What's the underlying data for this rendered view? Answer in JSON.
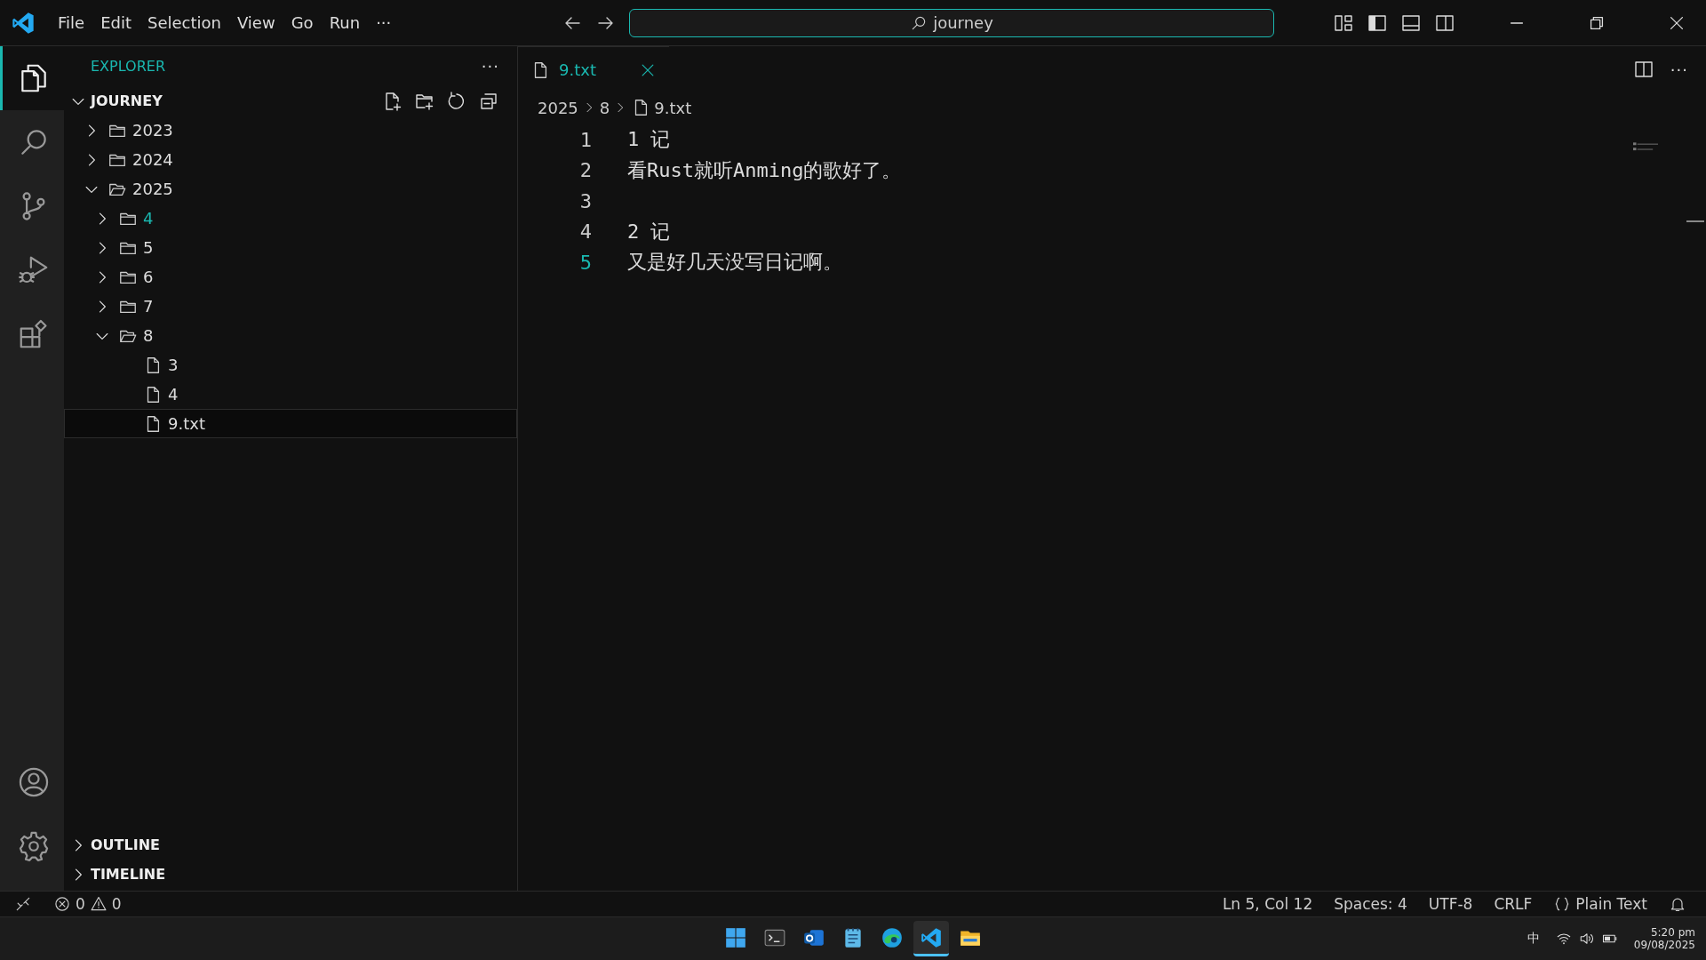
{
  "title_bar": {
    "menu": [
      "File",
      "Edit",
      "Selection",
      "View",
      "Go",
      "Run"
    ],
    "more": "···",
    "search": {
      "value": "journey"
    }
  },
  "activity_bar": {
    "items": [
      {
        "kind": "explorer",
        "selected": true
      },
      {
        "kind": "search",
        "selected": false
      },
      {
        "kind": "source-control",
        "selected": false
      },
      {
        "kind": "run-debug",
        "selected": false
      },
      {
        "kind": "extensions",
        "selected": false
      }
    ],
    "bottom": [
      {
        "kind": "account"
      },
      {
        "kind": "settings"
      }
    ]
  },
  "sidebar": {
    "title": "EXPLORER",
    "more": "···",
    "root": {
      "label": "JOURNEY",
      "expanded": true
    },
    "tree": [
      {
        "kind": "folder",
        "label": "2023",
        "expanded": false,
        "highlighted": false,
        "selected": false
      },
      {
        "kind": "folder",
        "label": "2024",
        "expanded": false,
        "highlighted": false,
        "selected": false
      },
      {
        "kind": "folder",
        "label": "2025",
        "expanded": true,
        "highlighted": false,
        "selected": false,
        "children": [
          {
            "kind": "folder",
            "label": "4",
            "expanded": false,
            "highlighted": true,
            "selected": false
          },
          {
            "kind": "folder",
            "label": "5",
            "expanded": false,
            "highlighted": false,
            "selected": false
          },
          {
            "kind": "folder",
            "label": "6",
            "expanded": false,
            "highlighted": false,
            "selected": false
          },
          {
            "kind": "folder",
            "label": "7",
            "expanded": false,
            "highlighted": false,
            "selected": false
          },
          {
            "kind": "folder",
            "label": "8",
            "expanded": true,
            "highlighted": false,
            "selected": false,
            "children": [
              {
                "kind": "file",
                "label": "3",
                "highlighted": false,
                "selected": false
              },
              {
                "kind": "file",
                "label": "4",
                "highlighted": false,
                "selected": false
              },
              {
                "kind": "file",
                "label": "9.txt",
                "highlighted": false,
                "selected": true
              }
            ]
          }
        ]
      }
    ],
    "sections": [
      {
        "label": "OUTLINE",
        "expanded": false
      },
      {
        "label": "TIMELINE",
        "expanded": false
      }
    ]
  },
  "editor": {
    "tabs": [
      {
        "label": "9.txt",
        "selected": true
      }
    ],
    "breadcrumbs": [
      "2025",
      "8",
      "9.txt"
    ],
    "lines": [
      {
        "number": "1",
        "text": "1 记",
        "current": false
      },
      {
        "number": "2",
        "text": "看Rust就听Anming的歌好了。",
        "current": false
      },
      {
        "number": "3",
        "current": false
      },
      {
        "number": "4",
        "text": "2 记",
        "current": false
      },
      {
        "number": "5",
        "text": "又是好几天没写日记啊。",
        "current": true
      }
    ]
  },
  "status_bar": {
    "errors": "0",
    "warnings": "0",
    "items": [
      {
        "kind": "text",
        "label": "Ln 5, Col 12"
      },
      {
        "kind": "text",
        "label": "Spaces: 4"
      },
      {
        "kind": "text",
        "label": "UTF-8"
      },
      {
        "kind": "text",
        "label": "CRLF"
      },
      {
        "kind": "language",
        "label": "Plain Text"
      }
    ]
  },
  "taskbar": {
    "apps": [
      {
        "kind": "start",
        "selected": false
      },
      {
        "kind": "terminal",
        "selected": false
      },
      {
        "kind": "mail",
        "selected": false
      },
      {
        "kind": "notepad",
        "selected": false
      },
      {
        "kind": "browser",
        "selected": false
      },
      {
        "kind": "editor",
        "selected": true
      },
      {
        "kind": "files",
        "selected": false
      }
    ],
    "tray": {
      "ime": "中",
      "time": "5:20 pm",
      "date": "09/08/2025"
    }
  }
}
